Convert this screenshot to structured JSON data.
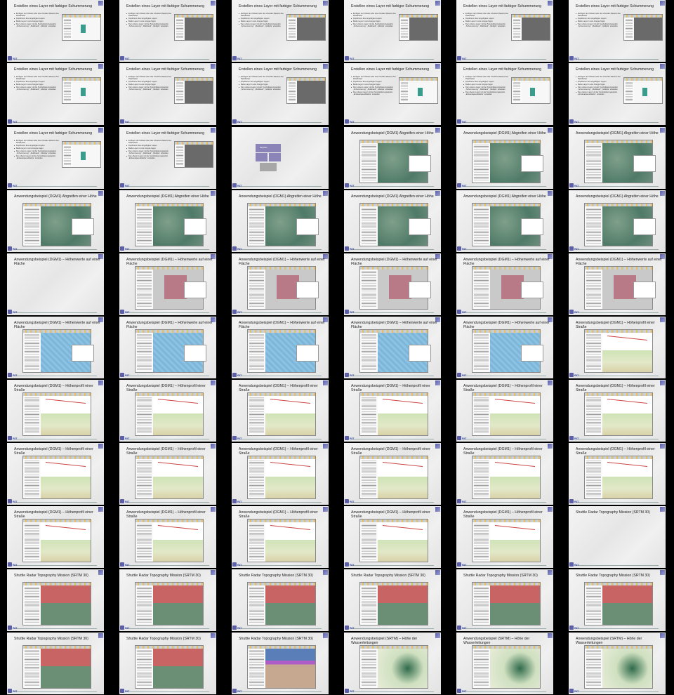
{
  "footer": {
    "logo": "BIT"
  },
  "slides": [
    {
      "title": "Erstellen eines Layer mit farbiger Schummerung",
      "kind": "layer",
      "bullets": [
        "Einfügen der tif-Datei oder des virtuellen Rasters des Reliefraster",
        "Duplizieren des eingefügten Layers",
        "Beide Layer in eine Gruppe fügen",
        "Den unteren Layer mit der Symbolisierungsoption „Schummerung“, „Multiband“, „Multiple“ einstellen"
      ]
    },
    {
      "title": "Erstellen eines Layer mit farbiger Schummerung",
      "kind": "layer-dark",
      "bullets": [
        "Einfügen der tif-Datei oder des virtuellen Rasters des Reliefraster",
        "Duplizieren des eingefügten Layers",
        "Beide Layer in eine Gruppe fügen",
        "Den unteren Layer mit der Symbolisierungsoption „Schummerung“, „Multiband“, „Multiple“ einstellen"
      ]
    },
    {
      "title": "Erstellen eines Layer mit farbiger Schummerung",
      "kind": "layer-dark",
      "bullets": [
        "Einfügen der tif-Datei oder des virtuellen Rasters des Reliefraster",
        "Duplizieren des eingefügten Layers",
        "Beide Layer in eine Gruppe fügen",
        "Den unteren Layer mit der Symbolisierungsoption „Schummerung“, „Multiband“, „Multiple“ einstellen"
      ]
    },
    {
      "title": "Erstellen eines Layer mit farbiger Schummerung",
      "kind": "layer-dark",
      "bullets": [
        "Einfügen der tif-Datei oder des virtuellen Rasters des Reliefraster",
        "Duplizieren des eingefügten Layers",
        "Beide Layer in eine Gruppe fügen",
        "Den unteren Layer mit der Symbolisierungsoption „Schummerung“, „Multiband“, „Multiple“ einstellen"
      ]
    },
    {
      "title": "Erstellen eines Layer mit farbiger Schummerung",
      "kind": "layer-dark",
      "bullets": [
        "Einfügen der tif-Datei oder des virtuellen Rasters des Reliefraster",
        "Duplizieren des eingefügten Layers",
        "Beide Layer in eine Gruppe fügen",
        "Den unteren Layer mit der Symbolisierungsoption „Schummerung“, „Multiband“, „Multiple“ einstellen"
      ]
    },
    {
      "title": "Erstellen eines Layer mit farbiger Schummerung",
      "kind": "layer-dark",
      "bullets": [
        "Einfügen der tif-Datei oder des virtuellen Rasters des Reliefraster",
        "Duplizieren des eingefügten Layers",
        "Beide Layer in eine Gruppe fügen",
        "Den unteren Layer mit der Symbolisierungsoption „Schummerung“, „Multiband“, „Multiple“ einstellen"
      ]
    },
    {
      "title": "Erstellen eines Layer mit farbiger Schummerung",
      "kind": "layer",
      "bullets": [
        "Einfügen der tif-Datei oder des virtuellen Rasters des Reliefraster",
        "Duplizieren des eingefügten Layers",
        "Beide Layer in eine Gruppe fügen",
        "Den unteren Layer mit der Symbolisierungsoption „Schummerung“, „Multiband“, „Multiple“ einstellen"
      ]
    },
    {
      "title": "Erstellen eines Layer mit farbiger Schummerung",
      "kind": "layer-dark",
      "bullets": [
        "Einfügen der tif-Datei oder des virtuellen Rasters des Reliefraster",
        "Duplizieren des eingefügten Layers",
        "Beide Layer in eine Gruppe fügen",
        "Den unteren Layer mit der Symbolisierungsoption „Schummerung“, „Multiband“, „Multiple“ einstellen"
      ]
    },
    {
      "title": "Erstellen eines Layer mit farbiger Schummerung",
      "kind": "layer-dark",
      "bullets": [
        "Einfügen der tif-Datei oder des virtuellen Rasters des Reliefraster",
        "Duplizieren des eingefügten Layers",
        "Beide Layer in eine Gruppe fügen",
        "Den unteren Layer mit der Symbolisierungsoption „Schummerung“, „Multiband“, „Multiple“ einstellen"
      ]
    },
    {
      "title": "Erstellen eines Layer mit farbiger Schummerung",
      "kind": "layer",
      "bullets": [
        "Einfügen der tif-Datei oder des virtuellen Rasters des Reliefraster",
        "Duplizieren des eingefügten Layers",
        "Beide Layer in eine Gruppe fügen",
        "Den unteren Layer mit der Symbolisierungsoption „Schummerung“, „Multiband“, „Multiple“ einstellen",
        "Den oberen Layer mit der Symbolisierungsoption „Einkanalpseudofarbe“ einstellen"
      ]
    },
    {
      "title": "Erstellen eines Layer mit farbiger Schummerung",
      "kind": "layer",
      "bullets": [
        "Einfügen der tif-Datei oder des virtuellen Rasters des Reliefraster",
        "Duplizieren des eingefügten Layers",
        "Beide Layer in eine Gruppe fügen",
        "Den unteren Layer mit der Symbolisierungsoption „Schummerung“, „Multiband“, „Multiple“ einstellen",
        "Den oberen Layer mit der Symbolisierungsoption „Einkanalpseudofarbe“ einstellen"
      ]
    },
    {
      "title": "Erstellen eines Layer mit farbiger Schummerung",
      "kind": "layer",
      "bullets": [
        "Einfügen der tif-Datei oder des virtuellen Rasters des Reliefraster",
        "Duplizieren des eingefügten Layers",
        "Beide Layer in eine Gruppe fügen",
        "Den unteren Layer mit der Symbolisierungsoption „Schummerung“, „Multiband“, „Multiple“ einstellen",
        "Den oberen Layer mit der Symbolisierungsoption „Einkanalpseudofarbe“ einstellen"
      ]
    },
    {
      "title": "Erstellen eines Layer mit farbiger Schummerung",
      "kind": "layer",
      "bullets": [
        "Einfügen der tif-Datei oder des virtuellen Rasters des Reliefraster",
        "Duplizieren des eingefügten Layers",
        "Beide Layer in eine Gruppe fügen",
        "Den unteren Layer mit der Symbolisierungsoption „Schummerung“, „Multiband“, „Multiple“ einstellen",
        "Den oberen Layer mit der Symbolisierungsoption „Einkanalpseudofarbe“ einstellen"
      ]
    },
    {
      "title": "Erstellen eines Layer mit farbiger Schummerung",
      "kind": "layer-dark",
      "bullets": [
        "Einfügen der tif-Datei oder des virtuellen Rasters des Reliefraster",
        "Duplizieren des eingefügten Layers",
        "Beide Layer in eine Gruppe fügen",
        "Den unteren Layer mit der Symbolisierungsoption „Schummerung“, „Multiband“, „Multiple“ einstellen",
        "Den oberen Layer mit der Symbolisierungsoption „Einkanalpseudofarbe“ einstellen"
      ]
    },
    {
      "title": "",
      "kind": "boxes",
      "label": "Beispiele",
      "bullets": []
    },
    {
      "title": "Anwendungsbeispiel (DGM1) Abgreifen einer Höhe",
      "kind": "dgm",
      "bullets": []
    },
    {
      "title": "Anwendungsbeispiel (DGM1) Abgreifen einer Höhe",
      "kind": "dgm",
      "bullets": []
    },
    {
      "title": "Anwendungsbeispiel (DGM1) Abgreifen einer Höhe",
      "kind": "dgm",
      "bullets": []
    },
    {
      "title": "Anwendungsbeispiel (DGM1) Abgreifen einer Höhe",
      "kind": "dgm",
      "bullets": []
    },
    {
      "title": "Anwendungsbeispiel (DGM1) Abgreifen einer Höhe",
      "kind": "dgm",
      "bullets": []
    },
    {
      "title": "Anwendungsbeispiel (DGM1) Abgreifen einer Höhe",
      "kind": "dgm",
      "bullets": []
    },
    {
      "title": "Anwendungsbeispiel (DGM1) Abgreifen einer Höhe",
      "kind": "dgm",
      "bullets": []
    },
    {
      "title": "Anwendungsbeispiel (DGM1) Abgreifen einer Höhe",
      "kind": "dgm",
      "bullets": []
    },
    {
      "title": "Anwendungsbeispiel (DGM1) Abgreifen einer Höhe",
      "kind": "dgm",
      "bullets": []
    },
    {
      "title": "Anwendungsbeispiel (DGM1) – Höhenwerte auf einer Fläche",
      "kind": "blank",
      "bullets": []
    },
    {
      "title": "Anwendungsbeispiel (DGM1) – Höhenwerte auf einer Fläche",
      "kind": "red",
      "bullets": []
    },
    {
      "title": "Anwendungsbeispiel (DGM1) – Höhenwerte auf einer Fläche",
      "kind": "red",
      "bullets": []
    },
    {
      "title": "Anwendungsbeispiel (DGM1) – Höhenwerte auf einer Fläche",
      "kind": "red",
      "bullets": []
    },
    {
      "title": "Anwendungsbeispiel (DGM1) – Höhenwerte auf einer Fläche",
      "kind": "red",
      "bullets": []
    },
    {
      "title": "Anwendungsbeispiel (DGM1) – Höhenwerte auf einer Fläche",
      "kind": "red",
      "bullets": []
    },
    {
      "title": "Anwendungsbeispiel (DGM1) – Höhenwerte auf einer Fläche",
      "kind": "blue",
      "bullets": []
    },
    {
      "title": "Anwendungsbeispiel (DGM1) – Höhenwerte auf einer Fläche",
      "kind": "blue",
      "bullets": []
    },
    {
      "title": "Anwendungsbeispiel (DGM1) – Höhenwerte auf einer Fläche",
      "kind": "blue",
      "bullets": []
    },
    {
      "title": "Anwendungsbeispiel (DGM1) – Höhenwerte auf einer Fläche",
      "kind": "blue",
      "bullets": []
    },
    {
      "title": "Anwendungsbeispiel (DGM1) – Höhenwerte auf einer Fläche",
      "kind": "blue",
      "bullets": []
    },
    {
      "title": "Anwendungsbeispiel (DGM1) – Höhenprofil einer Straße",
      "kind": "prof",
      "bullets": []
    },
    {
      "title": "Anwendungsbeispiel (DGM1) – Höhenprofil einer Straße",
      "kind": "prof",
      "bullets": []
    },
    {
      "title": "Anwendungsbeispiel (DGM1) – Höhenprofil einer Straße",
      "kind": "prof",
      "bullets": []
    },
    {
      "title": "Anwendungsbeispiel (DGM1) – Höhenprofil einer Straße",
      "kind": "prof",
      "bullets": []
    },
    {
      "title": "Anwendungsbeispiel (DGM1) – Höhenprofil einer Straße",
      "kind": "prof",
      "bullets": []
    },
    {
      "title": "Anwendungsbeispiel (DGM1) – Höhenprofil einer Straße",
      "kind": "prof",
      "bullets": []
    },
    {
      "title": "Anwendungsbeispiel (DGM1) – Höhenprofil einer Straße",
      "kind": "prof",
      "bullets": []
    },
    {
      "title": "Anwendungsbeispiel (DGM1) – Höhenprofil einer Straße",
      "kind": "prof",
      "bullets": []
    },
    {
      "title": "Anwendungsbeispiel (DGM1) – Höhenprofil einer Straße",
      "kind": "prof",
      "bullets": []
    },
    {
      "title": "Anwendungsbeispiel (DGM1) – Höhenprofil einer Straße",
      "kind": "prof",
      "bullets": []
    },
    {
      "title": "Anwendungsbeispiel (DGM1) – Höhenprofil einer Straße",
      "kind": "prof",
      "bullets": []
    },
    {
      "title": "Anwendungsbeispiel (DGM1) – Höhenprofil einer Straße",
      "kind": "prof",
      "bullets": []
    },
    {
      "title": "Anwendungsbeispiel (DGM1) – Höhenprofil einer Straße",
      "kind": "prof",
      "bullets": []
    },
    {
      "title": "Anwendungsbeispiel (DGM1) – Höhenprofil einer Straße",
      "kind": "prof",
      "bullets": []
    },
    {
      "title": "Anwendungsbeispiel (DGM1) – Höhenprofil einer Straße",
      "kind": "prof",
      "bullets": []
    },
    {
      "title": "Anwendungsbeispiel (DGM1) – Höhenprofil einer Straße",
      "kind": "prof",
      "bullets": []
    },
    {
      "title": "Anwendungsbeispiel (DGM1) – Höhenprofil einer Straße",
      "kind": "prof",
      "bullets": []
    },
    {
      "title": "Anwendungsbeispiel (DGM1) – Höhenprofil einer Straße",
      "kind": "prof",
      "bullets": []
    },
    {
      "title": "Shuttle Radar Topography Mission (SRTM 30)",
      "kind": "blank",
      "bullets": []
    },
    {
      "title": "Shuttle Radar Topography Mission (SRTM 30)",
      "kind": "srtm",
      "bullets": []
    },
    {
      "title": "Shuttle Radar Topography Mission (SRTM 30)",
      "kind": "srtm",
      "bullets": []
    },
    {
      "title": "Shuttle Radar Topography Mission (SRTM 30)",
      "kind": "srtm",
      "bullets": []
    },
    {
      "title": "Shuttle Radar Topography Mission (SRTM 30)",
      "kind": "srtm",
      "bullets": []
    },
    {
      "title": "Shuttle Radar Topography Mission (SRTM 30)",
      "kind": "srtm",
      "bullets": []
    },
    {
      "title": "Shuttle Radar Topography Mission (SRTM 30)",
      "kind": "srtm",
      "bullets": []
    },
    {
      "title": "Shuttle Radar Topography Mission (SRTM 30)",
      "kind": "srtm",
      "bullets": []
    },
    {
      "title": "Shuttle Radar Topography Mission (SRTM 30)",
      "kind": "srtm",
      "bullets": []
    },
    {
      "title": "Shuttle Radar Topography Mission (SRTM 30)",
      "kind": "srtm2",
      "bullets": []
    },
    {
      "title": "Anwendungsbeispiel (SRTM) – Höhe der Wasserleitungen",
      "kind": "water",
      "bullets": []
    },
    {
      "title": "Anwendungsbeispiel (SRTM) – Höhe der Wasserleitungen",
      "kind": "water",
      "bullets": []
    },
    {
      "title": "Anwendungsbeispiel (SRTM) – Höhe der Wasserleitungen",
      "kind": "water",
      "bullets": []
    }
  ]
}
